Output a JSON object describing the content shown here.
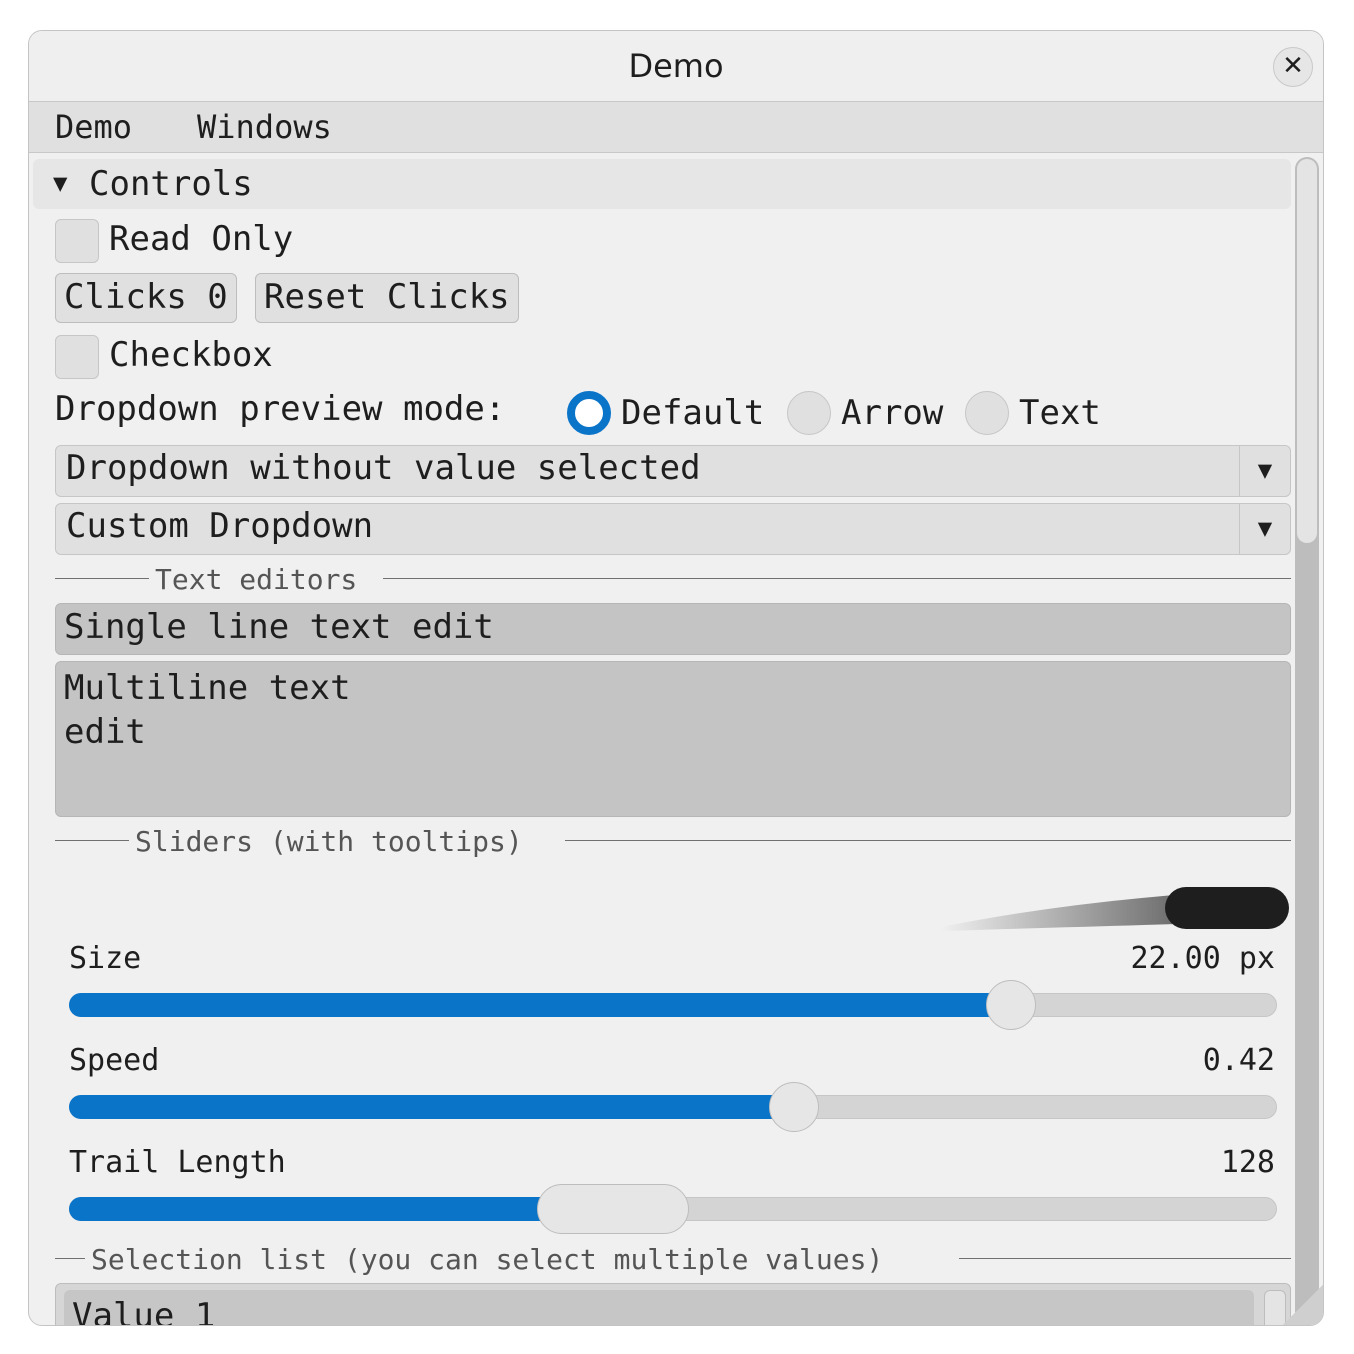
{
  "window": {
    "title": "Demo",
    "close_icon": "close-icon"
  },
  "menubar": {
    "items": [
      "Demo",
      "Windows"
    ]
  },
  "controls": {
    "header": "Controls",
    "read_only_label": "Read Only",
    "clicks_button": "Clicks 0",
    "reset_button": "Reset Clicks",
    "checkbox_label": "Checkbox",
    "preview_mode_label": "Dropdown preview mode:",
    "radios": [
      "Default",
      "Arrow",
      "Text"
    ],
    "selected_radio": "Default",
    "dropdown1": "Dropdown without value selected",
    "dropdown2": "Custom Dropdown"
  },
  "text_editors": {
    "section": "Text editors",
    "single": "Single line text edit",
    "multi": "Multiline text\nedit"
  },
  "sliders": {
    "section": "Sliders (with tooltips)",
    "items": [
      {
        "label": "Size",
        "value": "22.00 px",
        "fraction": 0.78
      },
      {
        "label": "Speed",
        "value": "0.42",
        "fraction": 0.6
      },
      {
        "label": "Trail Length",
        "value": "128",
        "fraction": 0.45
      }
    ]
  },
  "selection": {
    "section": "Selection list (you can select multiple values)",
    "items": [
      "Value 1"
    ]
  },
  "colors": {
    "accent": "#0a74c9",
    "background": "#f0f0f0"
  }
}
